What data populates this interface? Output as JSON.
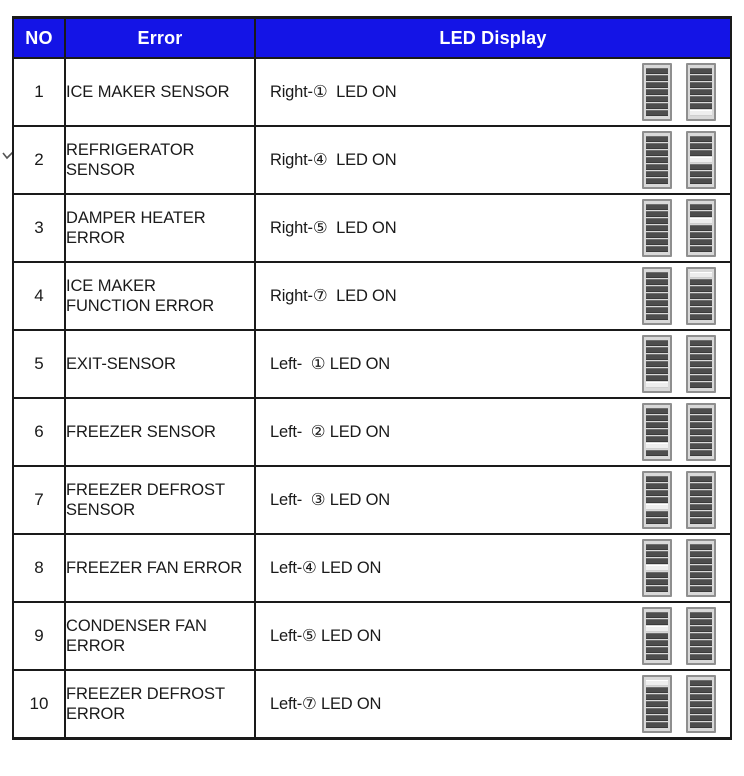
{
  "table": {
    "columns": [
      {
        "key": "no",
        "label": "NO"
      },
      {
        "key": "error",
        "label": "Error"
      },
      {
        "key": "led",
        "label": "LED Display"
      }
    ],
    "header_bg": "#1414e6",
    "header_fg": "#ffffff",
    "border_color": "#1a1a1a",
    "rows": [
      {
        "no": "1",
        "error_line1": "ICE MAKER SENSOR",
        "error_line2": "",
        "led_label": "Right-①  LED ON",
        "led_side": "right",
        "led_index": 1,
        "left_bar_segments": [
          0,
          0,
          0,
          0,
          0,
          0,
          0
        ],
        "right_bar_segments": [
          0,
          0,
          0,
          0,
          0,
          0,
          1
        ]
      },
      {
        "no": "2",
        "error_line1": "REFRIGERATOR",
        "error_line2": "SENSOR",
        "led_label": "Right-④  LED ON",
        "led_side": "right",
        "led_index": 4,
        "left_bar_segments": [
          0,
          0,
          0,
          0,
          0,
          0,
          0
        ],
        "right_bar_segments": [
          0,
          0,
          0,
          1,
          0,
          0,
          0
        ]
      },
      {
        "no": "3",
        "error_line1": "DAMPER HEATER",
        "error_line2": "ERROR",
        "led_label": "Right-⑤  LED ON",
        "led_side": "right",
        "led_index": 5,
        "left_bar_segments": [
          0,
          0,
          0,
          0,
          0,
          0,
          0
        ],
        "right_bar_segments": [
          0,
          0,
          1,
          0,
          0,
          0,
          0
        ]
      },
      {
        "no": "4",
        "error_line1": "ICE MAKER",
        "error_line2": "FUNCTION ERROR",
        "led_label": "Right-⑦  LED ON",
        "led_side": "right",
        "led_index": 7,
        "left_bar_segments": [
          0,
          0,
          0,
          0,
          0,
          0,
          0
        ],
        "right_bar_segments": [
          1,
          0,
          0,
          0,
          0,
          0,
          0
        ]
      },
      {
        "no": "5",
        "error_line1": "EXIT-SENSOR",
        "error_line2": "",
        "led_label": "Left-  ① LED ON",
        "led_side": "left",
        "led_index": 1,
        "left_bar_segments": [
          0,
          0,
          0,
          0,
          0,
          0,
          1
        ],
        "right_bar_segments": [
          0,
          0,
          0,
          0,
          0,
          0,
          0
        ]
      },
      {
        "no": "6",
        "error_line1": "FREEZER SENSOR",
        "error_line2": "",
        "led_label": "Left-  ② LED ON",
        "led_side": "left",
        "led_index": 2,
        "left_bar_segments": [
          0,
          0,
          0,
          0,
          0,
          1,
          0
        ],
        "right_bar_segments": [
          0,
          0,
          0,
          0,
          0,
          0,
          0
        ]
      },
      {
        "no": "7",
        "error_line1": "FREEZER DEFROST",
        "error_line2": "SENSOR",
        "led_label": "Left-  ③ LED ON",
        "led_side": "left",
        "led_index": 3,
        "left_bar_segments": [
          0,
          0,
          0,
          0,
          1,
          0,
          0
        ],
        "right_bar_segments": [
          0,
          0,
          0,
          0,
          0,
          0,
          0
        ]
      },
      {
        "no": "8",
        "error_line1": "FREEZER FAN ERROR",
        "error_line2": "",
        "led_label": "Left-④ LED ON",
        "led_side": "left",
        "led_index": 4,
        "left_bar_segments": [
          0,
          0,
          0,
          1,
          0,
          0,
          0
        ],
        "right_bar_segments": [
          0,
          0,
          0,
          0,
          0,
          0,
          0
        ]
      },
      {
        "no": "9",
        "error_line1": "CONDENSER FAN",
        "error_line2": "ERROR",
        "led_label": "Left-⑤ LED ON",
        "led_side": "left",
        "led_index": 5,
        "left_bar_segments": [
          0,
          0,
          1,
          0,
          0,
          0,
          0
        ],
        "right_bar_segments": [
          0,
          0,
          0,
          0,
          0,
          0,
          0
        ]
      },
      {
        "no": "10",
        "error_line1": "FREEZER DEFROST",
        "error_line2": "ERROR",
        "led_label": "Left-⑦ LED ON",
        "led_side": "left",
        "led_index": 7,
        "left_bar_segments": [
          1,
          0,
          0,
          0,
          0,
          0,
          0
        ],
        "right_bar_segments": [
          0,
          0,
          0,
          0,
          0,
          0,
          0
        ]
      }
    ]
  }
}
